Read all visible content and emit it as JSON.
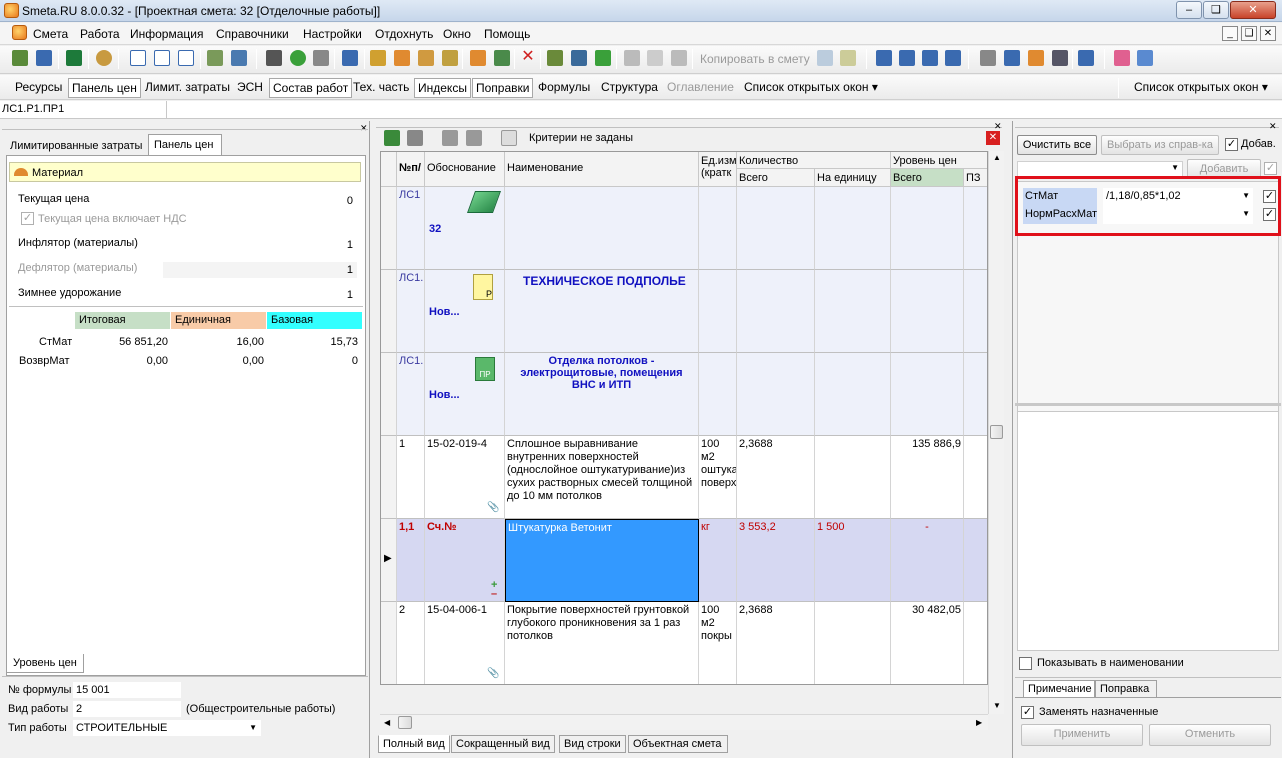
{
  "title_bar": {
    "app": "Smeta.RU  8.0.0.32",
    "doc": " - [Проектная смета: 32 [Отделочные работы]]"
  },
  "menu": [
    "Смета",
    "Работа",
    "Информация",
    "Справочники",
    "Настройки",
    "Отдохнуть",
    "Окно",
    "Помощь"
  ],
  "toolbar1": {
    "copy_label": "Копировать в смету"
  },
  "toolbar2": {
    "tabs": [
      "Ресурсы",
      "Панель цен",
      "Лимит. затраты",
      "ЭСН",
      "Состав работ",
      "Тех. часть",
      "Индексы",
      "Поправки",
      "Формулы",
      "Структура",
      "Оглавление",
      "Список открытых окон"
    ],
    "right_menu": "Список открытых окон"
  },
  "path": "ЛС1.Р1.ПР1",
  "left": {
    "tabs": [
      "Лимитированные затраты",
      "Панель цен"
    ],
    "material_header": "Материал",
    "current_price_label": "Текущая цена",
    "current_price_value": "0",
    "vat_label": "Текущая цена включает НДС",
    "inflator_label": "Инфлятор (материалы)",
    "inflator_value": "1",
    "deflator_label": "Дефлятор (материалы)",
    "deflator_value": "1",
    "winter_label": "Зимнее удорожание",
    "winter_value": "1",
    "cols": [
      "Итоговая",
      "Единичная",
      "Базовая"
    ],
    "rows": [
      {
        "name": "СтМат",
        "v": [
          "56 851,20",
          "16,00",
          "15,73"
        ]
      },
      {
        "name": "ВозврМат",
        "v": [
          "0,00",
          "0,00",
          "0"
        ]
      }
    ],
    "bottom_tab": "Уровень цен",
    "formula_no_label": "№ формулы",
    "formula_no_value": "15 001",
    "work_kind_label": "Вид работы",
    "work_kind_value": "2",
    "work_kind_desc": "(Общестроительные работы)",
    "work_type_label": "Тип работы",
    "work_type_value": "СТРОИТЕЛЬНЫЕ"
  },
  "grid": {
    "criteria": "Критерии не заданы",
    "headers": {
      "num": "№п/",
      "basis": "Обоснование",
      "name": "Наименование",
      "unit": "Ед.изм.(кратк",
      "qty": "Количество",
      "qty_total": "Всего",
      "qty_unit": "На единицу",
      "price_level": "Уровень цен",
      "pl_total": "Всего",
      "pl_pz": "ПЗ"
    },
    "rows": [
      {
        "num": "ЛС1",
        "basis": "32",
        "name": "",
        "type": "section"
      },
      {
        "num": "ЛС1.",
        "basis": "Нов...",
        "name": "ТЕХНИЧЕСКОЕ ПОДПОЛЬЕ",
        "type": "section"
      },
      {
        "num": "ЛС1.",
        "basis": "Нов...",
        "name": "Отделка потолков - электрощитовые, помещения ВНС и ИТП",
        "type": "section"
      },
      {
        "num": "1",
        "basis": "15-02-019-4",
        "name": "Сплошное выравнивание внутренних поверхностей (однослойное оштукатуривание)из сухих растворных смесей толщиной до 10 мм потолков",
        "unit": "100 м2 оштука поверх",
        "qty": "2,3688",
        "qty_unit": "",
        "total": "135 886,9",
        "type": "item"
      },
      {
        "num": "1,1",
        "basis": "Сч.№",
        "name": "Штукатурка Ветонит",
        "unit": "кг",
        "qty": "3 553,2",
        "qty_unit": "1 500",
        "total": "-",
        "type": "material"
      },
      {
        "num": "2",
        "basis": "15-04-006-1",
        "name": "Покрытие поверхностей грунтовкой глубокого проникновения за 1 раз потолков",
        "unit": "100 м2 покры",
        "qty": "2,3688",
        "qty_unit": "",
        "total": "30 482,05",
        "type": "item"
      }
    ],
    "bottom_tabs": [
      "Полный вид",
      "Сокращенный вид",
      "Вид строки",
      "Объектная смета"
    ]
  },
  "right": {
    "clear_all": "Очистить все",
    "select_from_ref": "Выбрать из справ-ка",
    "add_check_label": "Добав.",
    "add_button": "Добавить",
    "items": [
      {
        "name": "СтМат",
        "value": "/1,18/0,85*1,02"
      },
      {
        "name": "НормРасхМат",
        "value": ""
      }
    ],
    "show_in_name": "Показывать в наименовании",
    "tabs": [
      "Примечание",
      "Поправка"
    ],
    "replace_assigned": "Заменять назначенные",
    "apply": "Применить",
    "cancel": "Отменить"
  },
  "colors": {
    "highlight_red": "#e0101a",
    "selected_cell": "#3399ff",
    "itog": "#c6dfc6",
    "edin": "#f8cba8",
    "baz": "#33ffff"
  }
}
